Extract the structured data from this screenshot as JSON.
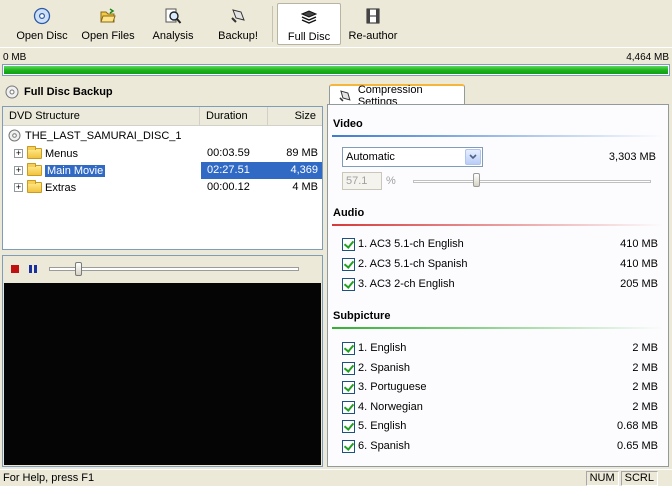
{
  "toolbar": {
    "buttons": [
      {
        "label": "Open Disc",
        "icon": "disc-icon"
      },
      {
        "label": "Open Files",
        "icon": "open-folder-icon"
      },
      {
        "label": "Analysis",
        "icon": "magnifier-icon"
      },
      {
        "label": "Backup!",
        "icon": "backup-icon"
      },
      {
        "label": "Full Disc",
        "icon": "stack-icon",
        "active": true
      },
      {
        "label": "Re-author",
        "icon": "film-icon"
      }
    ]
  },
  "size_bar": {
    "min_label": "0 MB",
    "max_label": "4,464 MB",
    "fill_fraction": 1.0,
    "color": "#1fb51f"
  },
  "left": {
    "title": "Full Disc Backup",
    "tree": {
      "headers": {
        "structure": "DVD Structure",
        "duration": "Duration",
        "size": "Size"
      },
      "root": "THE_LAST_SAMURAI_DISC_1",
      "items": [
        {
          "name": "Menus",
          "duration": "00:03.59",
          "size": "89 MB"
        },
        {
          "name": "Main Movie",
          "duration": "02:27.51",
          "size": "4,369 MB",
          "selected": true
        },
        {
          "name": "Extras",
          "duration": "00:00.12",
          "size": "4 MB"
        }
      ]
    },
    "player": {
      "position_fraction": 0.1
    }
  },
  "right": {
    "tab_label": "Compression Settings",
    "video": {
      "title": "Video",
      "mode": "Automatic",
      "size": "3,303 MB",
      "quality_value": "57.1",
      "quality_unit": "%"
    },
    "audio": {
      "title": "Audio",
      "items": [
        {
          "label": "1. AC3 5.1-ch English",
          "size": "410 MB"
        },
        {
          "label": "2. AC3 5.1-ch Spanish",
          "size": "410 MB"
        },
        {
          "label": "3. AC3 2-ch English",
          "size": "205 MB"
        }
      ]
    },
    "subpicture": {
      "title": "Subpicture",
      "items": [
        {
          "label": "1. English",
          "size": "2 MB"
        },
        {
          "label": "2. Spanish",
          "size": "2 MB"
        },
        {
          "label": "3. Portuguese",
          "size": "2 MB"
        },
        {
          "label": "4. Norwegian",
          "size": "2 MB"
        },
        {
          "label": "5. English",
          "size": "0.68 MB"
        },
        {
          "label": "6. Spanish",
          "size": "0.65 MB"
        }
      ]
    }
  },
  "status": {
    "help_text": "For Help, press F1",
    "num": "NUM",
    "scrl": "SCRL"
  }
}
